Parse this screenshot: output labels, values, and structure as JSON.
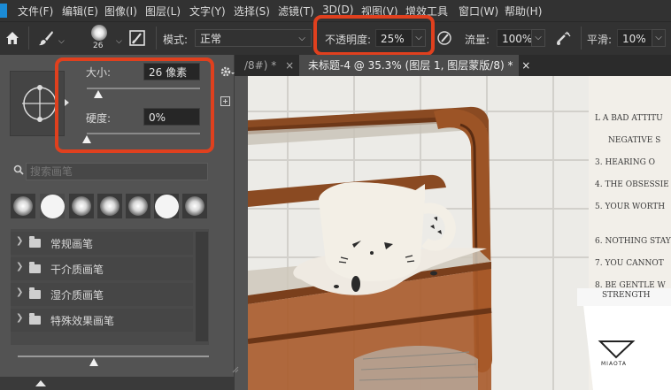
{
  "menu": [
    "文件(F)",
    "编辑(E)",
    "图像(I)",
    "图层(L)",
    "文字(Y)",
    "选择(S)",
    "滤镜(T)",
    "3D(D)",
    "视图(V)",
    "增效工具",
    "窗口(W)",
    "帮助(H)"
  ],
  "options_bar": {
    "brush_size": "26",
    "mode_label": "模式:",
    "mode_value": "正常",
    "opacity_label": "不透明度:",
    "opacity_value": "25%",
    "flow_label": "流量:",
    "flow_value": "100%",
    "smoothing_label": "平滑:",
    "smoothing_value": "10%",
    "dropdown_glyph": "⌵"
  },
  "tabs": [
    {
      "label": "/8#) *",
      "close": "×"
    },
    {
      "label": "未标题-4 @ 35.3% (图层 1, 图层蒙版/8) *",
      "close": "×"
    }
  ],
  "brush_panel": {
    "size_label": "大小:",
    "size_value": "26 像素",
    "size_fraction": 0.1,
    "hardness_label": "硬度:",
    "hardness_value": "0%",
    "hardness_fraction": 0.0,
    "search_placeholder": "搜索画笔",
    "groups": [
      "常规画笔",
      "干介质画笔",
      "湿介质画笔",
      "特殊效果画笔"
    ],
    "preview_size_fraction": 0.4
  },
  "canvas_text": {
    "sign_lines": [
      "L A BAD ATTITU",
      "NEGATIVE S",
      "3. HEARING O",
      "4. THE OBSESSIE",
      "5. YOUR WORTH",
      "6. NOTHING STAY",
      "7. YOU CANNOT",
      "8. BE GENTLE W",
      "STRENGTH"
    ],
    "cup_brand": "MIAOTA"
  },
  "colors": {
    "highlight": "#e0401e",
    "wood": "#8a4a22",
    "wood_dark": "#5a2c12",
    "accent_blue": "#1b8bd6"
  }
}
